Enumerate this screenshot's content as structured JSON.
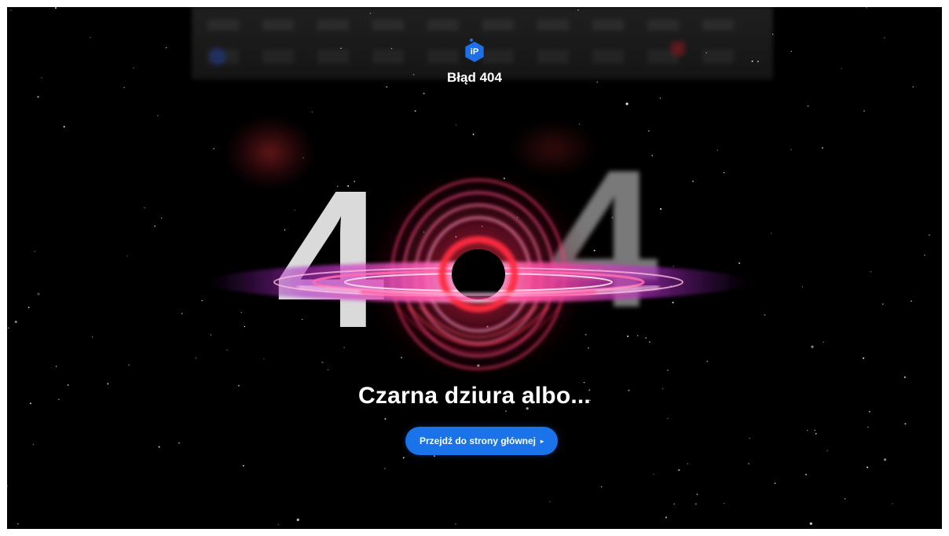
{
  "colors": {
    "background": "#000000",
    "accent": "#1a73e8",
    "text": "#ffffff"
  },
  "header": {
    "logo_text": "iP",
    "title": "Błąd 404"
  },
  "hero": {
    "digit_left": "4",
    "digit_right": "4"
  },
  "headline": "Czarna dziura albo...",
  "cta": {
    "label": "Przejdź do strony głównej",
    "icon": "chevron-right-icon",
    "arrow": "▸"
  }
}
